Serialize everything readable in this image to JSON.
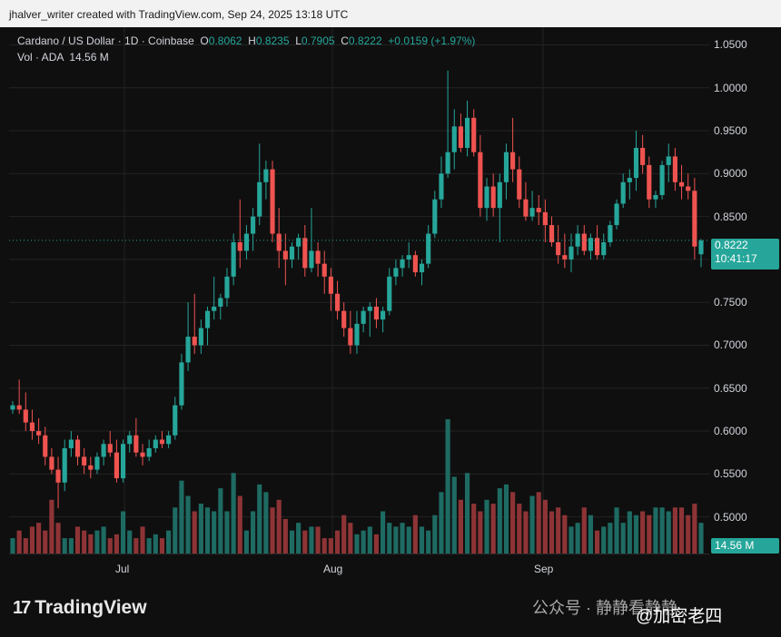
{
  "header": {
    "text": "jhalver_writer created with TradingView.com, Sep 24, 2025 13:18 UTC"
  },
  "legend": {
    "symbol": "Cardano / US Dollar · 1D · Coinbase",
    "o_label": "O",
    "o": "0.8062",
    "h_label": "H",
    "h": "0.8235",
    "l_label": "L",
    "l": "0.7905",
    "c_label": "C",
    "c": "0.8222",
    "change": "+0.0159 (+1.97%)",
    "vol_label": "Vol · ADA",
    "vol": "14.56 M"
  },
  "price_badge": {
    "price": "0.8222",
    "countdown": "10:41:17"
  },
  "volume_badge": "14.56 M",
  "footer": {
    "brand": "TradingView",
    "watermark": "公众号 · 静静看静静",
    "watermark2": "@加密老四"
  },
  "colors": {
    "up": "#26a69a",
    "down": "#ef5350",
    "up_vol": "#1e6b63",
    "down_vol": "#8e3436",
    "background": "#0f0f0f",
    "grid": "#232323"
  },
  "chart_data": {
    "type": "candlestick",
    "title": "Cardano / US Dollar · 1D · Coinbase",
    "y_ticks": [
      "1.0500",
      "1.0000",
      "0.9500",
      "0.9000",
      "0.8500",
      "0.8000",
      "0.7500",
      "0.7000",
      "0.6500",
      "0.6000",
      "0.5500",
      "0.5000"
    ],
    "x_ticks": [
      "Jul",
      "Aug",
      "Sep"
    ],
    "last_price": 0.8222,
    "ylim": [
      0.45,
      1.07
    ],
    "grid": true,
    "candles": [
      [
        0.625,
        0.635,
        0.62,
        0.63
      ],
      [
        0.63,
        0.66,
        0.62,
        0.625
      ],
      [
        0.625,
        0.645,
        0.6,
        0.61
      ],
      [
        0.61,
        0.625,
        0.59,
        0.6
      ],
      [
        0.6,
        0.615,
        0.585,
        0.595
      ],
      [
        0.595,
        0.605,
        0.56,
        0.57
      ],
      [
        0.57,
        0.58,
        0.55,
        0.555
      ],
      [
        0.555,
        0.57,
        0.51,
        0.54
      ],
      [
        0.54,
        0.59,
        0.53,
        0.58
      ],
      [
        0.58,
        0.6,
        0.57,
        0.59
      ],
      [
        0.59,
        0.595,
        0.56,
        0.57
      ],
      [
        0.57,
        0.58,
        0.55,
        0.56
      ],
      [
        0.56,
        0.57,
        0.545,
        0.555
      ],
      [
        0.555,
        0.575,
        0.55,
        0.57
      ],
      [
        0.57,
        0.59,
        0.56,
        0.585
      ],
      [
        0.585,
        0.6,
        0.57,
        0.575
      ],
      [
        0.575,
        0.59,
        0.54,
        0.545
      ],
      [
        0.545,
        0.59,
        0.54,
        0.585
      ],
      [
        0.585,
        0.6,
        0.575,
        0.595
      ],
      [
        0.595,
        0.615,
        0.57,
        0.575
      ],
      [
        0.575,
        0.585,
        0.56,
        0.57
      ],
      [
        0.57,
        0.59,
        0.565,
        0.58
      ],
      [
        0.58,
        0.595,
        0.575,
        0.59
      ],
      [
        0.59,
        0.6,
        0.58,
        0.585
      ],
      [
        0.585,
        0.6,
        0.58,
        0.595
      ],
      [
        0.595,
        0.64,
        0.59,
        0.63
      ],
      [
        0.63,
        0.69,
        0.625,
        0.68
      ],
      [
        0.68,
        0.75,
        0.67,
        0.71
      ],
      [
        0.71,
        0.76,
        0.69,
        0.7
      ],
      [
        0.7,
        0.73,
        0.69,
        0.72
      ],
      [
        0.72,
        0.745,
        0.7,
        0.74
      ],
      [
        0.74,
        0.78,
        0.73,
        0.745
      ],
      [
        0.745,
        0.76,
        0.73,
        0.755
      ],
      [
        0.755,
        0.79,
        0.745,
        0.78
      ],
      [
        0.78,
        0.83,
        0.77,
        0.82
      ],
      [
        0.82,
        0.87,
        0.79,
        0.81
      ],
      [
        0.81,
        0.84,
        0.8,
        0.83
      ],
      [
        0.83,
        0.86,
        0.81,
        0.85
      ],
      [
        0.85,
        0.935,
        0.84,
        0.89
      ],
      [
        0.89,
        0.915,
        0.87,
        0.905
      ],
      [
        0.905,
        0.915,
        0.82,
        0.83
      ],
      [
        0.83,
        0.86,
        0.79,
        0.81
      ],
      [
        0.81,
        0.83,
        0.77,
        0.8
      ],
      [
        0.8,
        0.82,
        0.79,
        0.815
      ],
      [
        0.815,
        0.83,
        0.8,
        0.825
      ],
      [
        0.825,
        0.84,
        0.78,
        0.79
      ],
      [
        0.79,
        0.86,
        0.785,
        0.81
      ],
      [
        0.81,
        0.82,
        0.78,
        0.795
      ],
      [
        0.795,
        0.81,
        0.76,
        0.78
      ],
      [
        0.78,
        0.79,
        0.74,
        0.76
      ],
      [
        0.76,
        0.775,
        0.73,
        0.74
      ],
      [
        0.74,
        0.75,
        0.71,
        0.72
      ],
      [
        0.72,
        0.74,
        0.69,
        0.7
      ],
      [
        0.7,
        0.74,
        0.69,
        0.725
      ],
      [
        0.725,
        0.745,
        0.715,
        0.74
      ],
      [
        0.74,
        0.75,
        0.71,
        0.745
      ],
      [
        0.745,
        0.755,
        0.72,
        0.73
      ],
      [
        0.73,
        0.745,
        0.715,
        0.74
      ],
      [
        0.74,
        0.79,
        0.735,
        0.78
      ],
      [
        0.78,
        0.8,
        0.77,
        0.79
      ],
      [
        0.79,
        0.805,
        0.78,
        0.8
      ],
      [
        0.8,
        0.82,
        0.79,
        0.805
      ],
      [
        0.805,
        0.81,
        0.78,
        0.785
      ],
      [
        0.785,
        0.8,
        0.77,
        0.795
      ],
      [
        0.795,
        0.84,
        0.79,
        0.83
      ],
      [
        0.83,
        0.88,
        0.825,
        0.87
      ],
      [
        0.87,
        0.92,
        0.86,
        0.9
      ],
      [
        0.9,
        1.02,
        0.895,
        0.925
      ],
      [
        0.925,
        0.975,
        0.905,
        0.955
      ],
      [
        0.955,
        0.97,
        0.925,
        0.93
      ],
      [
        0.93,
        0.985,
        0.92,
        0.965
      ],
      [
        0.965,
        0.975,
        0.92,
        0.925
      ],
      [
        0.925,
        0.945,
        0.85,
        0.86
      ],
      [
        0.86,
        0.895,
        0.845,
        0.885
      ],
      [
        0.885,
        0.9,
        0.85,
        0.86
      ],
      [
        0.86,
        0.9,
        0.82,
        0.89
      ],
      [
        0.89,
        0.935,
        0.87,
        0.925
      ],
      [
        0.925,
        0.965,
        0.89,
        0.905
      ],
      [
        0.905,
        0.92,
        0.86,
        0.87
      ],
      [
        0.87,
        0.89,
        0.845,
        0.85
      ],
      [
        0.85,
        0.88,
        0.845,
        0.86
      ],
      [
        0.86,
        0.875,
        0.84,
        0.855
      ],
      [
        0.855,
        0.87,
        0.82,
        0.84
      ],
      [
        0.84,
        0.85,
        0.815,
        0.82
      ],
      [
        0.82,
        0.84,
        0.795,
        0.805
      ],
      [
        0.805,
        0.83,
        0.79,
        0.8
      ],
      [
        0.8,
        0.83,
        0.785,
        0.815
      ],
      [
        0.815,
        0.84,
        0.805,
        0.83
      ],
      [
        0.83,
        0.84,
        0.805,
        0.81
      ],
      [
        0.81,
        0.83,
        0.8,
        0.825
      ],
      [
        0.825,
        0.84,
        0.8,
        0.805
      ],
      [
        0.805,
        0.83,
        0.8,
        0.82
      ],
      [
        0.82,
        0.845,
        0.815,
        0.84
      ],
      [
        0.84,
        0.87,
        0.835,
        0.865
      ],
      [
        0.865,
        0.9,
        0.86,
        0.89
      ],
      [
        0.89,
        0.905,
        0.87,
        0.895
      ],
      [
        0.895,
        0.95,
        0.88,
        0.93
      ],
      [
        0.93,
        0.945,
        0.9,
        0.91
      ],
      [
        0.91,
        0.92,
        0.86,
        0.87
      ],
      [
        0.87,
        0.88,
        0.86,
        0.875
      ],
      [
        0.875,
        0.915,
        0.87,
        0.91
      ],
      [
        0.91,
        0.935,
        0.89,
        0.92
      ],
      [
        0.92,
        0.93,
        0.88,
        0.89
      ],
      [
        0.89,
        0.91,
        0.87,
        0.885
      ],
      [
        0.885,
        0.9,
        0.87,
        0.88
      ],
      [
        0.88,
        0.895,
        0.8,
        0.815
      ],
      [
        0.806,
        0.824,
        0.791,
        0.822
      ]
    ],
    "volumes": [
      20,
      30,
      20,
      35,
      40,
      30,
      70,
      40,
      20,
      20,
      35,
      30,
      25,
      30,
      35,
      20,
      25,
      55,
      30,
      20,
      35,
      20,
      25,
      20,
      30,
      60,
      95,
      75,
      55,
      65,
      60,
      55,
      85,
      55,
      105,
      75,
      30,
      55,
      90,
      80,
      60,
      70,
      45,
      30,
      40,
      30,
      35,
      35,
      20,
      20,
      30,
      50,
      40,
      25,
      30,
      35,
      25,
      55,
      40,
      35,
      40,
      35,
      50,
      35,
      30,
      50,
      80,
      175,
      100,
      70,
      105,
      65,
      55,
      70,
      65,
      85,
      90,
      80,
      65,
      55,
      75,
      80,
      70,
      55,
      60,
      50,
      35,
      40,
      60,
      50,
      30,
      35,
      40,
      60,
      40,
      55,
      50,
      55,
      50,
      60,
      60,
      55,
      60,
      60,
      50,
      65,
      40
    ]
  }
}
